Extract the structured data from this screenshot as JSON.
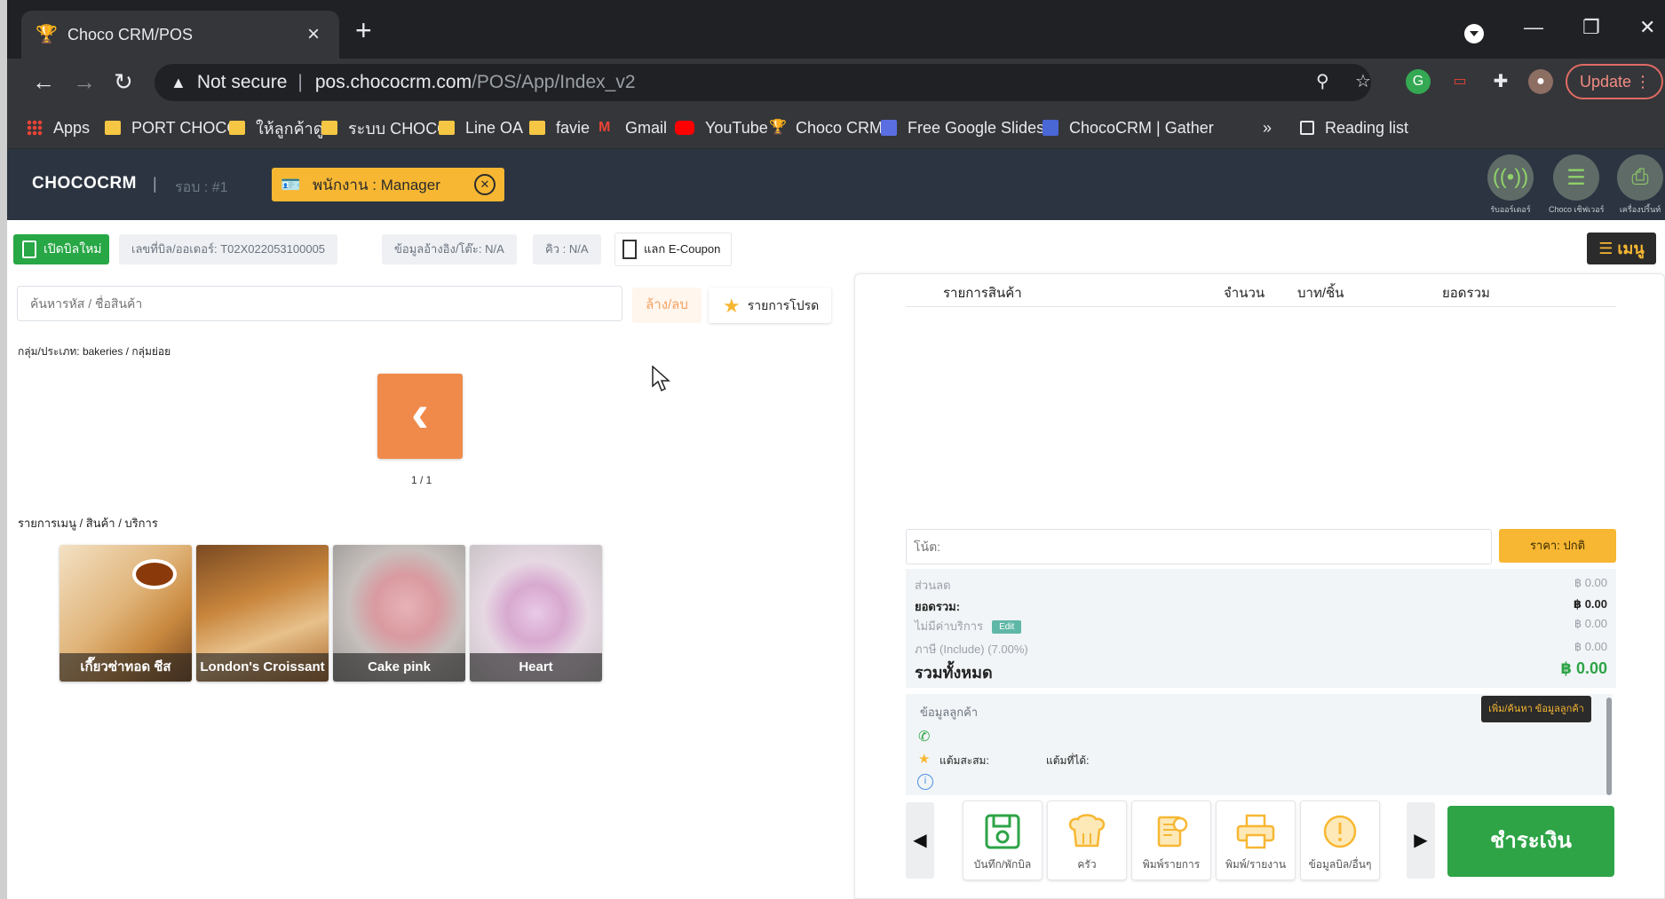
{
  "browser": {
    "tab_title": "Choco CRM/POS",
    "url_host": "pos.chococrm.com",
    "url_path": "/POS/App/Index_v2",
    "security_label": "Not secure",
    "update_label": "Update",
    "bookmarks": [
      {
        "label": "Apps",
        "icon": "apps-grid-icon"
      },
      {
        "label": "PORT CHOCO",
        "icon": "folder-icon"
      },
      {
        "label": "ให้ลูกค้าดู",
        "icon": "folder-icon"
      },
      {
        "label": "ระบบ CHOCO",
        "icon": "folder-icon"
      },
      {
        "label": "Line OA",
        "icon": "folder-icon"
      },
      {
        "label": "favie",
        "icon": "folder-icon"
      },
      {
        "label": "Gmail",
        "icon": "gmail-icon"
      },
      {
        "label": "YouTube",
        "icon": "youtube-icon"
      },
      {
        "label": "Choco CRM",
        "icon": "choco-icon"
      },
      {
        "label": "Free Google Slides...",
        "icon": "slides-icon"
      },
      {
        "label": "ChocoCRM | Gather",
        "icon": "gather-icon"
      }
    ],
    "overflow_label": "»",
    "reading_list_label": "Reading list"
  },
  "header": {
    "brand": "CHOCOCRM",
    "separator": "|",
    "round_label": "รอบ : #1",
    "staff_label": "พนักงาน : Manager",
    "tools": [
      {
        "label": "รับออร์เดอร์",
        "icon": "broadcast-icon"
      },
      {
        "label": "Choco เซิฟเวอร์",
        "icon": "server-icon"
      },
      {
        "label": "เครื่องปริ้นท์",
        "icon": "printer-icon"
      }
    ]
  },
  "subbar": {
    "new_bill": "เปิดบิลใหม่",
    "bill_number": "เลขที่บิล/ออเดอร์: T02X022053100005",
    "reference": "ข้อมูลอ้างอิง/โต๊ะ: N/A",
    "queue": "คิว : N/A",
    "coupon": "แลก E-Coupon",
    "menu": "เมนู"
  },
  "left": {
    "search_placeholder": "ค้นหารหัส / ชื่อสินค้า",
    "clear_label": "ล้าง/ลบ",
    "favorites_label": "รายการโปรด",
    "category_crumb": "กลุ่ม/ประเภท: bakeries / กลุ่มย่อย",
    "pager": "1 / 1",
    "section_title": "รายการเมนู / สินค้า / บริการ",
    "products": [
      {
        "name": "เกี๊ยวซ่าทอด ชีส"
      },
      {
        "name": "London's Croissant"
      },
      {
        "name": "Cake pink"
      },
      {
        "name": "Heart"
      }
    ]
  },
  "cart": {
    "columns": [
      "รายการสินค้า",
      "จำนวน",
      "บาท/ชิ้น",
      "ยอดรวม"
    ],
    "note_label": "โน้ต:",
    "price_type": "ราคา: ปกติ",
    "totals": [
      {
        "label": "ส่วนลด",
        "value": "฿ 0.00"
      },
      {
        "label": "ยอดรวม:",
        "value": "฿ 0.00"
      },
      {
        "label": "ไม่มีค่าบริการ",
        "value": "฿ 0.00",
        "tag": "Edit"
      },
      {
        "label": "ภาษี (Include) (7.00%)",
        "value": "฿ 0.00"
      }
    ],
    "grand_total_label": "รวมทั้งหมด",
    "grand_total_value": "฿ 0.00",
    "customer_title": "ข้อมูลลูกค้า",
    "add_customer": "เพิ่ม/ค้นหา ข้อมูลลูกค้า",
    "points_label": "แต้มสะสม:",
    "points_earned_label": "แต้มที่ได้:",
    "actions": [
      {
        "label": "บันทึก/พักบิล",
        "icon": "save-icon"
      },
      {
        "label": "ครัว",
        "icon": "chef-hat-icon"
      },
      {
        "label": "พิมพ์รายการ",
        "icon": "print-list-icon"
      },
      {
        "label": "พิมพ์/รายงาน",
        "icon": "printer-icon"
      },
      {
        "label": "ข้อมูลบิล/อื่นๆ",
        "icon": "info-icon"
      }
    ],
    "pay_label": "ชำระเงิน"
  }
}
